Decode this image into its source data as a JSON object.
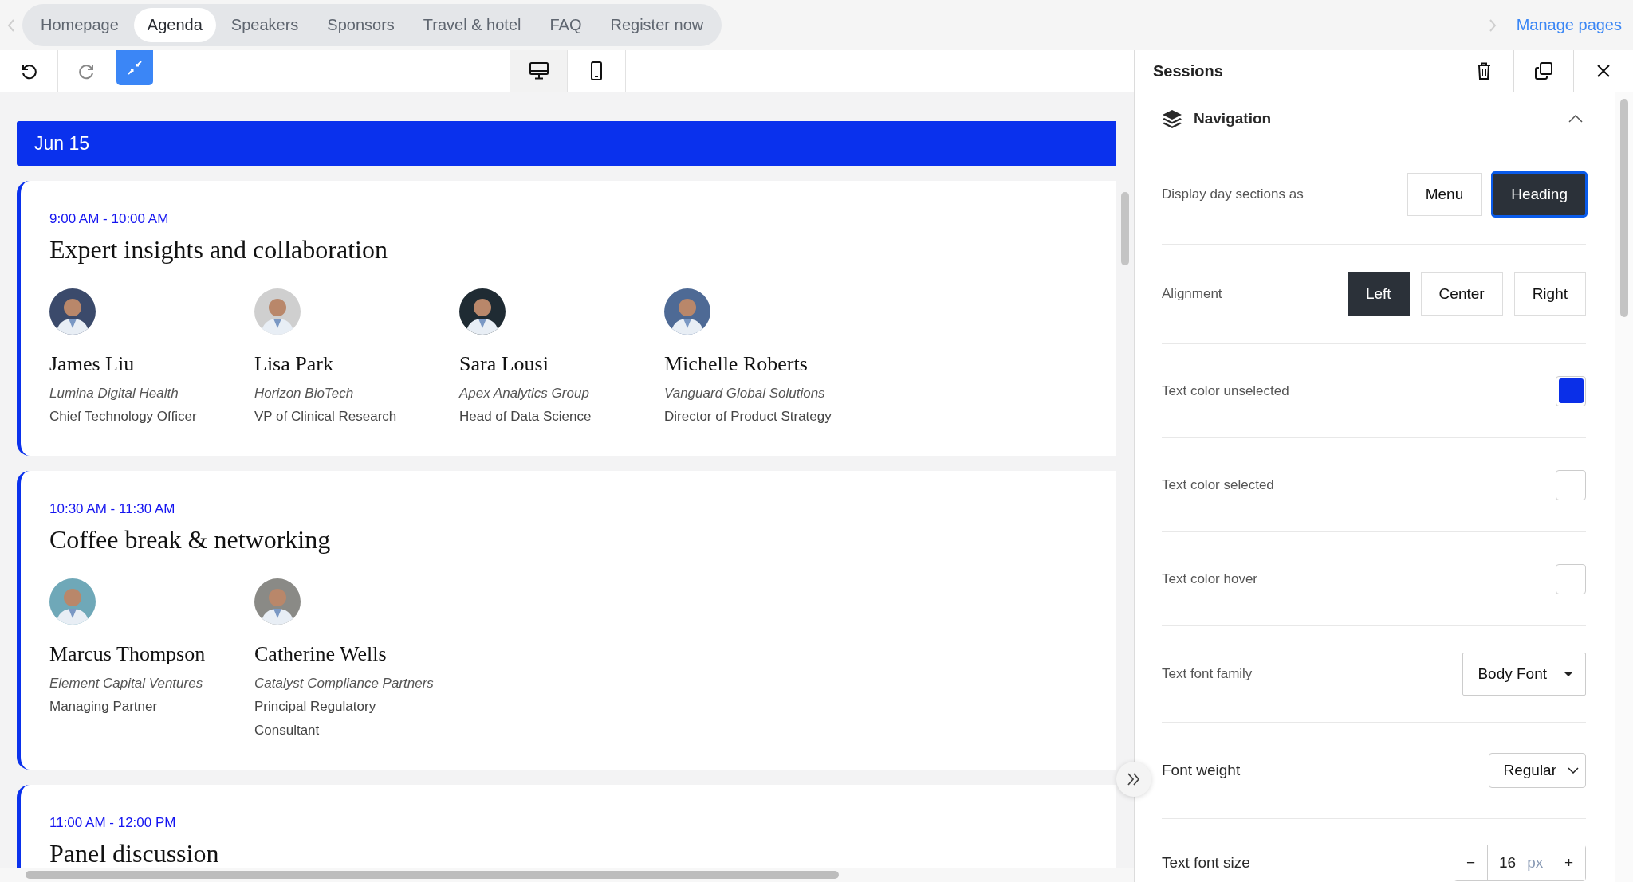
{
  "nav_tabs": [
    {
      "label": "Homepage",
      "selected": false
    },
    {
      "label": "Agenda",
      "selected": true
    },
    {
      "label": "Speakers",
      "selected": false
    },
    {
      "label": "Sponsors",
      "selected": false
    },
    {
      "label": "Travel & hotel",
      "selected": false
    },
    {
      "label": "FAQ",
      "selected": false
    },
    {
      "label": "Register now",
      "selected": false
    }
  ],
  "manage_pages": "Manage pages",
  "toolbar": {
    "collapse_selected": true,
    "view_modes": [
      {
        "kind": "desktop",
        "selected": true
      },
      {
        "kind": "mobile",
        "selected": false
      }
    ]
  },
  "agenda": {
    "day": "Jun 15",
    "sessions": [
      {
        "time": "9:00 AM - 10:00 AM",
        "title": "Expert insights and collaboration",
        "speakers": [
          {
            "name": "James Liu",
            "company": "Lumina Digital Health",
            "role": "Chief Technology Officer"
          },
          {
            "name": "Lisa Park",
            "company": "Horizon BioTech",
            "role": "VP of Clinical Research"
          },
          {
            "name": "Sara Lousi",
            "company": "Apex Analytics Group",
            "role": "Head of Data Science"
          },
          {
            "name": "Michelle Roberts",
            "company": "Vanguard Global Solutions",
            "role": "Director of Product Strategy"
          }
        ]
      },
      {
        "time": "10:30 AM - 11:30 AM",
        "title": "Coffee break & networking",
        "speakers": [
          {
            "name": "Marcus Thompson",
            "company": "Element Capital Ventures",
            "role": "Managing Partner"
          },
          {
            "name": "Catherine Wells",
            "company": "Catalyst Compliance Partners",
            "role": "Principal Regulatory Consultant"
          }
        ]
      },
      {
        "time": "11:00 AM - 12:00 PM",
        "title": "Panel discussion"
      }
    ]
  },
  "panel": {
    "title": "Sessions",
    "section": {
      "title": "Navigation",
      "expanded": true
    },
    "settings": [
      {
        "kind": "choice",
        "label": "Display day sections as",
        "options": [
          {
            "label": "Menu",
            "selected": false,
            "focused": false
          },
          {
            "label": "Heading",
            "selected": true,
            "focused": true
          }
        ]
      },
      {
        "kind": "choice",
        "label": "Alignment",
        "options": [
          {
            "label": "Left",
            "selected": true,
            "focused": false
          },
          {
            "label": "Center",
            "selected": false,
            "focused": false
          },
          {
            "label": "Right",
            "selected": false,
            "focused": false
          }
        ]
      },
      {
        "kind": "color",
        "label": "Text color unselected",
        "color": "#0a2fe8"
      },
      {
        "kind": "color",
        "label": "Text color selected",
        "color": "#ffffff"
      },
      {
        "kind": "color",
        "label": "Text color hover",
        "color": "#ffffff"
      },
      {
        "kind": "dropdown",
        "label": "Text font family",
        "value": "Body Font"
      },
      {
        "kind": "select",
        "label": "Font weight",
        "value": "Regular"
      },
      {
        "kind": "stepper",
        "label": "Text font size",
        "value": "16",
        "unit": "px",
        "decrement": "−",
        "increment": "+"
      }
    ]
  }
}
